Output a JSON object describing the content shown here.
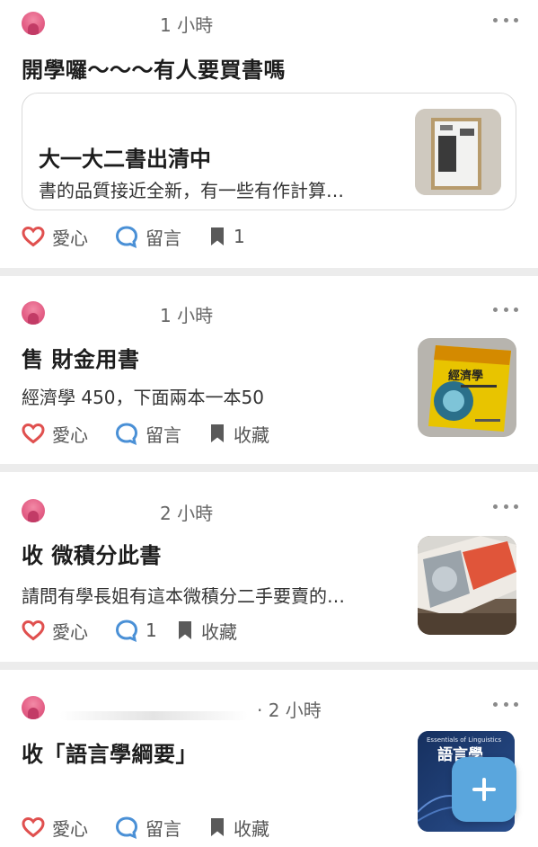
{
  "posts": [
    {
      "time": "1 小時",
      "title": "開學囉～～～有人要買書嗎",
      "card": {
        "title": "大一大二書出清中",
        "desc": "書的品質接近全新，有一些有作計算…"
      },
      "actions": {
        "like": "愛心",
        "comment": "留言",
        "save": "1"
      }
    },
    {
      "time": "1 小時",
      "title": "售 財金用書",
      "excerpt": "經濟學 450，下面兩本一本50",
      "actions": {
        "like": "愛心",
        "comment": "留言",
        "save": "收藏"
      }
    },
    {
      "time": "2 小時",
      "title": "收 微積分此書",
      "excerpt": "請問有學長姐有這本微積分二手要賣的…",
      "actions": {
        "like": "愛心",
        "comment": "1",
        "save": "收藏"
      }
    },
    {
      "time": "· 2 小時",
      "title": "收「語言學綱要」",
      "actions": {
        "like": "愛心",
        "comment": "留言",
        "save": "收藏"
      }
    }
  ],
  "thumbs": {
    "econ_cover_title": "經濟學",
    "ling_cover_title": "語言學",
    "ling_cover_sub": "Essentials of Linguistics"
  },
  "colors": {
    "heart": "#e0504f",
    "comment": "#4a90d6",
    "bookmark": "#5a5a5a",
    "fab": "#5aa6dd"
  },
  "icons": [
    "heart-outline-icon",
    "comment-bubble-icon",
    "bookmark-icon",
    "more-dots-icon",
    "plus-icon"
  ]
}
